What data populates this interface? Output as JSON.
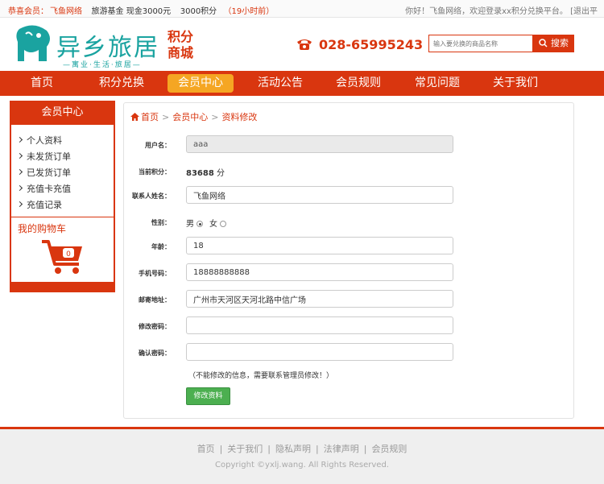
{
  "topbar": {
    "greeting_prefix": "恭喜会员：",
    "member_name": "飞鱼网络",
    "travel_fund": "旅游基金 现金3000元",
    "points": "3000积分",
    "time_ago": "（19小时前）",
    "welcome": "你好！飞鱼网络，欢迎登录xx积分兑换平台。 [退出平"
  },
  "header": {
    "logo_text": "异乡旅居",
    "logo_sub": "—寓业·生活·旅居—",
    "mall_line1": "积分",
    "mall_line2": "商城",
    "phone": "028-65995243",
    "search_placeholder": "输入要兑换的商品名称",
    "search_label": "搜索"
  },
  "nav": [
    {
      "label": "首页"
    },
    {
      "label": "积分兑换"
    },
    {
      "label": "会员中心"
    },
    {
      "label": "活动公告"
    },
    {
      "label": "会员规则"
    },
    {
      "label": "常见问题"
    },
    {
      "label": "关于我们"
    }
  ],
  "sidebar": {
    "title": "会员中心",
    "items": [
      {
        "label": "个人资料"
      },
      {
        "label": "未发货订单"
      },
      {
        "label": "已发货订单"
      },
      {
        "label": "充值卡充值"
      },
      {
        "label": "充值记录"
      }
    ],
    "cart_title": "我的购物车",
    "cart_count": "0"
  },
  "breadcrumb": {
    "home": "首页",
    "sep": ">",
    "level2": "会员中心",
    "level3": "资料修改"
  },
  "form": {
    "username_label": "用户名：",
    "username": "aaa",
    "points_label": "当前积分：",
    "points_value": "83688",
    "points_unit": " 分",
    "contact_label": "联系人姓名：",
    "contact": "飞鱼网络",
    "gender_label": "性别：",
    "gender_male": "男",
    "gender_female": "女",
    "age_label": "年龄：",
    "age": "18",
    "phone_label": "手机号码：",
    "phone": "18888888888",
    "address_label": "邮寄地址：",
    "address": "广州市天河区天河北路中信广场",
    "password_label": "修改密码：",
    "password": "",
    "confirm_label": "确认密码：",
    "confirm": "",
    "note": "（不能修改的信息，需要联系管理员修改！）",
    "submit_label": "修改资料"
  },
  "footer": {
    "links": [
      "首页",
      "关于我们",
      "隐私声明",
      "法律声明",
      "会员规则"
    ],
    "sep": "|",
    "copyright": "Copyright ©yxlj.wang. All Rights Reserved."
  },
  "colors": {
    "brand_red": "#d9360f",
    "nav_active": "#f5a623",
    "logo_teal": "#1aa3a0",
    "submit_green": "#4caf50"
  }
}
